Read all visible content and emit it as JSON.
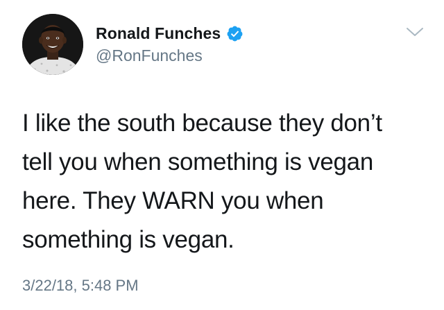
{
  "author": {
    "display_name": "Ronald Funches",
    "handle": "@RonFunches",
    "verified": true,
    "avatar_icon": "avatar-photo"
  },
  "tweet": {
    "text_lines": [
      "I like the south because they don’t",
      "tell you when something is vegan",
      "here. They WARN you when",
      "something is vegan."
    ],
    "timestamp": "3/22/18, 5:48 PM"
  },
  "icons": {
    "verified": "verified-badge-icon",
    "menu": "chevron-down-icon"
  },
  "colors": {
    "verified_blue": "#1da1f2",
    "secondary_text": "#657786",
    "primary_text": "#14171a",
    "chevron": "#aab8c2"
  }
}
